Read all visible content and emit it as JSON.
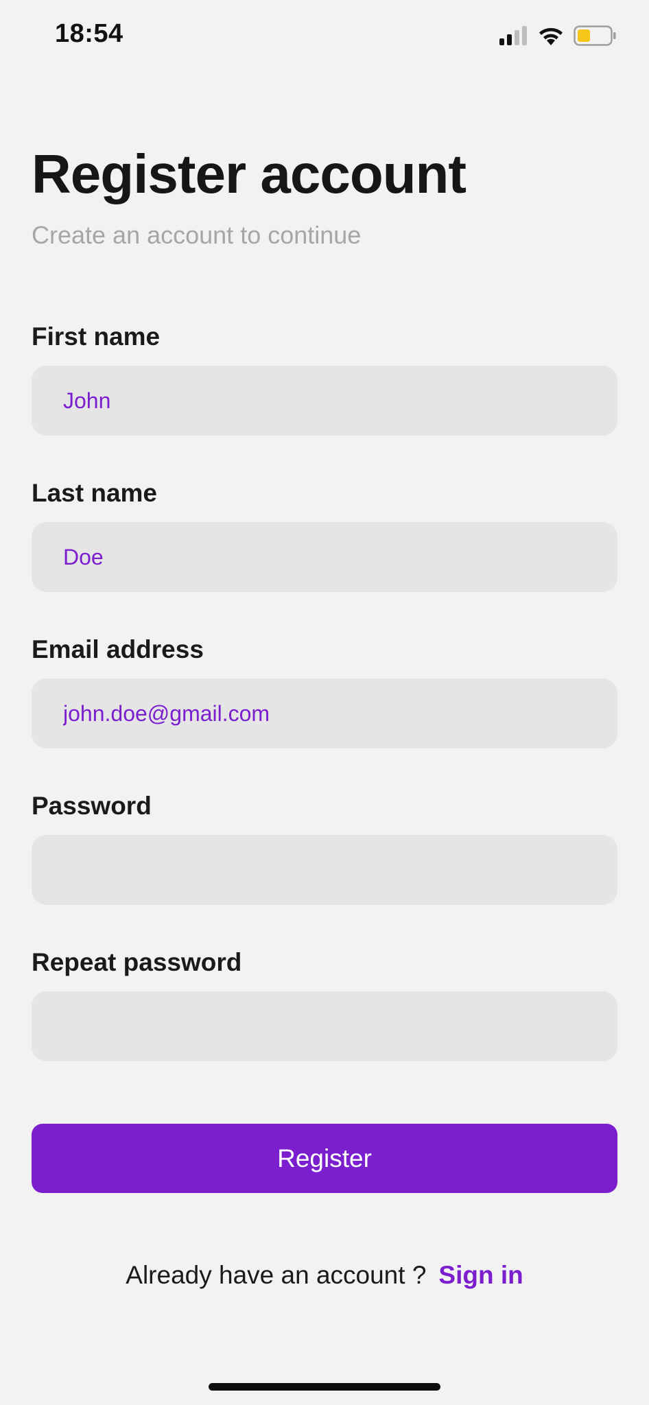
{
  "status_bar": {
    "time": "18:54",
    "icons": [
      "signal-icon",
      "wifi-icon",
      "battery-icon"
    ],
    "battery_color": "#f5c518"
  },
  "header": {
    "title": "Register account",
    "subtitle": "Create an account to continue"
  },
  "form": {
    "first_name": {
      "label": "First name",
      "value": "John"
    },
    "last_name": {
      "label": "Last name",
      "value": "Doe"
    },
    "email": {
      "label": "Email address",
      "value": "john.doe@gmail.com"
    },
    "password": {
      "label": "Password",
      "value": ""
    },
    "repeat_password": {
      "label": "Repeat password",
      "value": ""
    }
  },
  "actions": {
    "register_label": "Register"
  },
  "footer": {
    "prompt": "Already have an account ?",
    "signin_label": "Sign in"
  },
  "colors": {
    "accent": "#7b1fce",
    "background": "#f2f2f2",
    "input_background": "#e5e5e5",
    "subtitle": "#a6a6a6"
  }
}
